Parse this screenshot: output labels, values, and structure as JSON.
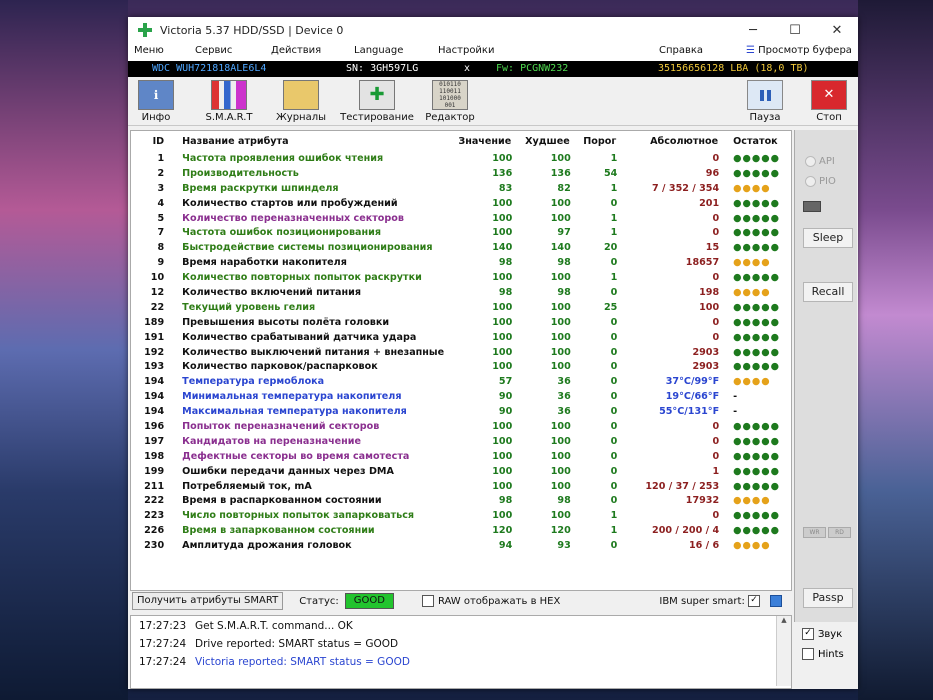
{
  "window": {
    "title": "Victoria 5.37 HDD/SSD | Device 0",
    "minimize": "─",
    "maximize": "☐",
    "close": "✕"
  },
  "menu": {
    "items": [
      "Меню",
      "Сервис",
      "Действия",
      "Language",
      "Настройки",
      "Справка",
      "Просмотр буфера"
    ]
  },
  "device": {
    "model": "WDC  WUH721818ALE6L4",
    "serial": "SN: 3GH597LG",
    "sep": "x",
    "firmware": "Fw: PCGNW232",
    "lba": "35156656128 LBA (18,0 TB)"
  },
  "toolbar": {
    "buttons": [
      "Инфо",
      "S.M.A.R.T",
      "Журналы",
      "Тестирование",
      "Редактор"
    ],
    "pause": "Пауза",
    "stop": "Стоп"
  },
  "table": {
    "headers": [
      "ID",
      "Название атрибута",
      "Значение",
      "Худшее",
      "Порог",
      "Абсолютное",
      "Остаток"
    ],
    "rows": [
      {
        "id": "1",
        "name": "Частота проявления ошибок чтения",
        "val": "100",
        "worst": "100",
        "thr": "1",
        "abs": "0",
        "rem": "●●●●●",
        "nc": "#2f7d17",
        "rc": "#1e7a1e"
      },
      {
        "id": "2",
        "name": "Производительность",
        "val": "136",
        "worst": "136",
        "thr": "54",
        "abs": "96",
        "rem": "●●●●●",
        "nc": "#2f7d17",
        "rc": "#1e7a1e"
      },
      {
        "id": "3",
        "name": "Время раскрутки шпинделя",
        "val": "83",
        "worst": "82",
        "thr": "1",
        "abs": "7 / 352 / 354",
        "rem": "●●●●",
        "nc": "#2f7d17",
        "rc": "#e5a21a"
      },
      {
        "id": "4",
        "name": "Количество стартов или пробуждений",
        "val": "100",
        "worst": "100",
        "thr": "0",
        "abs": "201",
        "rem": "●●●●●",
        "nc": "#111",
        "rc": "#1e7a1e"
      },
      {
        "id": "5",
        "name": "Количество переназначенных секторов",
        "val": "100",
        "worst": "100",
        "thr": "1",
        "abs": "0",
        "rem": "●●●●●",
        "nc": "#8a2f8f",
        "rc": "#1e7a1e"
      },
      {
        "id": "7",
        "name": "Частота ошибок позиционирования",
        "val": "100",
        "worst": "97",
        "thr": "1",
        "abs": "0",
        "rem": "●●●●●",
        "nc": "#2f7d17",
        "rc": "#1e7a1e"
      },
      {
        "id": "8",
        "name": "Быстродействие системы позиционирования",
        "val": "140",
        "worst": "140",
        "thr": "20",
        "abs": "15",
        "rem": "●●●●●",
        "nc": "#2f7d17",
        "rc": "#1e7a1e"
      },
      {
        "id": "9",
        "name": "Время наработки накопителя",
        "val": "98",
        "worst": "98",
        "thr": "0",
        "abs": "18657",
        "rem": "●●●●",
        "nc": "#111",
        "rc": "#e5a21a"
      },
      {
        "id": "10",
        "name": "Количество повторных попыток раскрутки",
        "val": "100",
        "worst": "100",
        "thr": "1",
        "abs": "0",
        "rem": "●●●●●",
        "nc": "#2f7d17",
        "rc": "#1e7a1e"
      },
      {
        "id": "12",
        "name": "Количество включений питания",
        "val": "98",
        "worst": "98",
        "thr": "0",
        "abs": "198",
        "rem": "●●●●",
        "nc": "#111",
        "rc": "#e5a21a"
      },
      {
        "id": "22",
        "name": "Текущий уровень гелия",
        "val": "100",
        "worst": "100",
        "thr": "25",
        "abs": "100",
        "rem": "●●●●●",
        "nc": "#2f7d17",
        "rc": "#1e7a1e"
      },
      {
        "id": "189",
        "name": "Превышения высоты полёта головки",
        "val": "100",
        "worst": "100",
        "thr": "0",
        "abs": "0",
        "rem": "●●●●●",
        "nc": "#111",
        "rc": "#1e7a1e"
      },
      {
        "id": "191",
        "name": "Количество срабатываний датчика удара",
        "val": "100",
        "worst": "100",
        "thr": "0",
        "abs": "0",
        "rem": "●●●●●",
        "nc": "#111",
        "rc": "#1e7a1e"
      },
      {
        "id": "192",
        "name": "Количество выключений питания + внезапные",
        "val": "100",
        "worst": "100",
        "thr": "0",
        "abs": "2903",
        "rem": "●●●●●",
        "nc": "#111",
        "rc": "#1e7a1e"
      },
      {
        "id": "193",
        "name": "Количество парковок/распарковок",
        "val": "100",
        "worst": "100",
        "thr": "0",
        "abs": "2903",
        "rem": "●●●●●",
        "nc": "#111",
        "rc": "#1e7a1e"
      },
      {
        "id": "194",
        "name": "Температура гермоблока",
        "val": "57",
        "worst": "36",
        "thr": "0",
        "abs": "37°C/99°F",
        "rem": "●●●●",
        "nc": "#2a45d0",
        "rc": "#e5a21a"
      },
      {
        "id": "194",
        "name": "Минимальная температура накопителя",
        "val": "90",
        "worst": "36",
        "thr": "0",
        "abs": "19°C/66°F",
        "rem": "-",
        "nc": "#2a45d0",
        "rc": "#111"
      },
      {
        "id": "194",
        "name": "Максимальная температура накопителя",
        "val": "90",
        "worst": "36",
        "thr": "0",
        "abs": "55°C/131°F",
        "rem": "-",
        "nc": "#2a45d0",
        "rc": "#111"
      },
      {
        "id": "196",
        "name": "Попыток переназначений секторов",
        "val": "100",
        "worst": "100",
        "thr": "0",
        "abs": "0",
        "rem": "●●●●●",
        "nc": "#8a2f8f",
        "rc": "#1e7a1e"
      },
      {
        "id": "197",
        "name": "Кандидатов на переназначение",
        "val": "100",
        "worst": "100",
        "thr": "0",
        "abs": "0",
        "rem": "●●●●●",
        "nc": "#8a2f8f",
        "rc": "#1e7a1e"
      },
      {
        "id": "198",
        "name": "Дефектные секторы во время самотеста",
        "val": "100",
        "worst": "100",
        "thr": "0",
        "abs": "0",
        "rem": "●●●●●",
        "nc": "#8a2f8f",
        "rc": "#1e7a1e"
      },
      {
        "id": "199",
        "name": "Ошибки передачи данных через DMA",
        "val": "100",
        "worst": "100",
        "thr": "0",
        "abs": "1",
        "rem": "●●●●●",
        "nc": "#111",
        "rc": "#1e7a1e"
      },
      {
        "id": "211",
        "name": "Потребляемый ток, mA",
        "val": "100",
        "worst": "100",
        "thr": "0",
        "abs": "120 / 37 / 253",
        "rem": "●●●●●",
        "nc": "#111",
        "rc": "#1e7a1e"
      },
      {
        "id": "222",
        "name": "Время в распаркованном состоянии",
        "val": "98",
        "worst": "98",
        "thr": "0",
        "abs": "17932",
        "rem": "●●●●",
        "nc": "#111",
        "rc": "#e5a21a"
      },
      {
        "id": "223",
        "name": "Число повторных попыток запарковаться",
        "val": "100",
        "worst": "100",
        "thr": "1",
        "abs": "0",
        "rem": "●●●●●",
        "nc": "#2f7d17",
        "rc": "#1e7a1e"
      },
      {
        "id": "226",
        "name": "Время в запаркованном состоянии",
        "val": "120",
        "worst": "120",
        "thr": "1",
        "abs": "200 / 200 / 4",
        "rem": "●●●●●",
        "nc": "#2f7d17",
        "rc": "#1e7a1e"
      },
      {
        "id": "230",
        "name": "Амплитуда дрожания головок",
        "val": "94",
        "worst": "93",
        "thr": "0",
        "abs": "16 / 6",
        "rem": "●●●●",
        "nc": "#111",
        "rc": "#e5a21a"
      }
    ]
  },
  "side": {
    "api": "API",
    "pio": "PIO",
    "sleep": "Sleep",
    "recall": "Recall",
    "wr": "WR",
    "rd": "RD",
    "passp": "Passp"
  },
  "status": {
    "get_button": "Получить атрибуты SMART",
    "label": "Статус:",
    "value": "GOOD",
    "raw_hex": "RAW отображать в HEX",
    "ibm": "IBM super smart:"
  },
  "log": [
    {
      "time": "17:27:23",
      "text": "Get S.M.A.R.T. command... OK",
      "color": "#111"
    },
    {
      "time": "17:27:24",
      "text": "Drive reported: SMART status = GOOD",
      "color": "#111"
    },
    {
      "time": "17:27:24",
      "text": "Victoria reported: SMART status = GOOD",
      "color": "#2a45d0"
    }
  ],
  "bottom": {
    "sound": "Звук",
    "hints": "Hints"
  }
}
